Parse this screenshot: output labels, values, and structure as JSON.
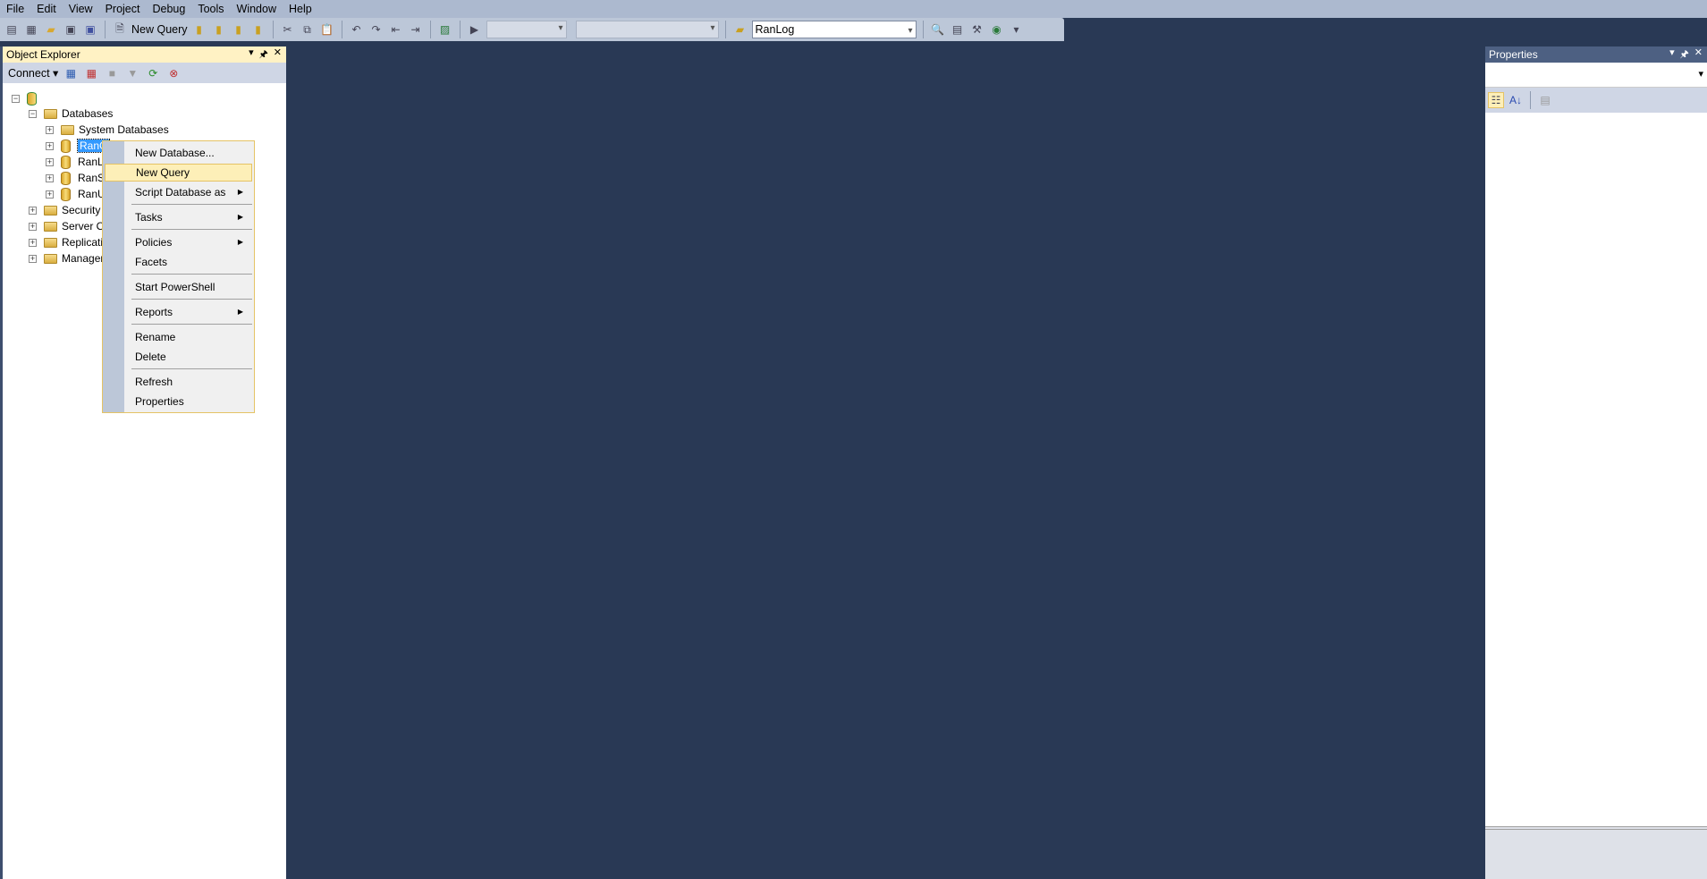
{
  "menu": [
    "File",
    "Edit",
    "View",
    "Project",
    "Debug",
    "Tools",
    "Window",
    "Help"
  ],
  "toolbar": {
    "new_query": "New Query",
    "database_combo": "RanLog"
  },
  "object_explorer": {
    "title": "Object Explorer",
    "connect": "Connect",
    "tree": [
      {
        "label": "",
        "icon": "server-icon",
        "expanded": true
      },
      {
        "label": "Databases",
        "icon": "folder-icon",
        "expanded": true
      },
      {
        "label": "System Databases",
        "icon": "folder-icon"
      },
      {
        "label": "RanG",
        "icon": "database-icon",
        "selected": true
      },
      {
        "label": "RanL",
        "icon": "database-icon"
      },
      {
        "label": "RanS",
        "icon": "database-icon"
      },
      {
        "label": "RanU",
        "icon": "database-icon"
      },
      {
        "label": "Security",
        "icon": "folder-icon"
      },
      {
        "label": "Server Ob",
        "icon": "folder-icon"
      },
      {
        "label": "Replicatio",
        "icon": "folder-icon"
      },
      {
        "label": "Manager",
        "icon": "folder-icon"
      }
    ]
  },
  "context_menu": [
    {
      "label": "New Database..."
    },
    {
      "label": "New Query",
      "highlighted": true
    },
    {
      "label": "Script Database as",
      "submenu": true
    },
    {
      "label": "Tasks",
      "submenu": true
    },
    {
      "label": "Policies",
      "submenu": true
    },
    {
      "label": "Facets"
    },
    {
      "label": "Start PowerShell"
    },
    {
      "label": "Reports",
      "submenu": true
    },
    {
      "label": "Rename"
    },
    {
      "label": "Delete"
    },
    {
      "label": "Refresh"
    },
    {
      "label": "Properties"
    }
  ],
  "properties": {
    "title": "Properties"
  }
}
